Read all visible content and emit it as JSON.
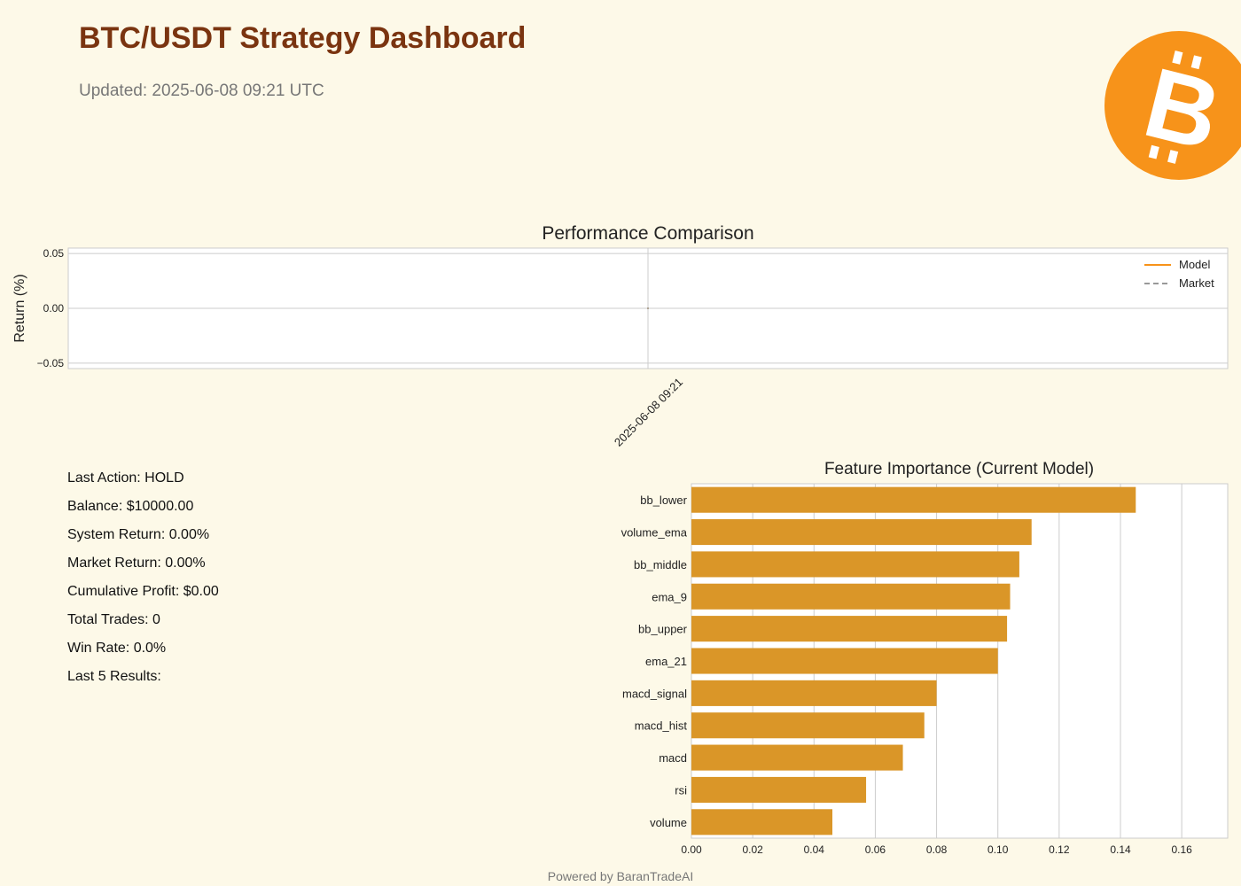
{
  "header": {
    "title": "BTC/USDT Strategy Dashboard",
    "updated": "Updated: 2025-06-08 09:21 UTC",
    "logo_icon": "bitcoin-icon"
  },
  "stats": [
    "Last Action: HOLD",
    "Balance: $10000.00",
    "System Return: 0.00%",
    "Market Return: 0.00%",
    "Cumulative Profit: $0.00",
    "Total Trades: 0",
    "Win Rate: 0.0%",
    "Last 5 Results:"
  ],
  "footer": "Powered by BaranTradeAI",
  "colors": {
    "accent": "#f7931a",
    "bar": "#da9628",
    "title": "#7a3410",
    "market": "#999999"
  },
  "chart_data": [
    {
      "type": "line",
      "title": "Performance Comparison",
      "xlabel": "",
      "ylabel": "Return (%)",
      "x": [
        "2025-06-08 09:21"
      ],
      "series": [
        {
          "name": "Model",
          "values": [
            0.0
          ],
          "style": "solid",
          "color": "#f7931a"
        },
        {
          "name": "Market",
          "values": [
            0.0
          ],
          "style": "dashed",
          "color": "#999999"
        }
      ],
      "yticks": [
        "0.05",
        "0.00",
        "−0.05"
      ],
      "ylim": [
        -0.055,
        0.055
      ],
      "grid": true,
      "legend": "top-right"
    },
    {
      "type": "bar",
      "orientation": "horizontal",
      "title": "Feature Importance (Current Model)",
      "categories": [
        "bb_lower",
        "volume_ema",
        "bb_middle",
        "ema_9",
        "bb_upper",
        "ema_21",
        "macd_signal",
        "macd_hist",
        "macd",
        "rsi",
        "volume"
      ],
      "values": [
        0.145,
        0.111,
        0.107,
        0.104,
        0.103,
        0.1,
        0.08,
        0.076,
        0.069,
        0.057,
        0.046
      ],
      "xticks": [
        "0.00",
        "0.02",
        "0.04",
        "0.06",
        "0.08",
        "0.10",
        "0.12",
        "0.14",
        "0.16"
      ],
      "xlim": [
        0,
        0.175
      ],
      "grid": true
    }
  ]
}
